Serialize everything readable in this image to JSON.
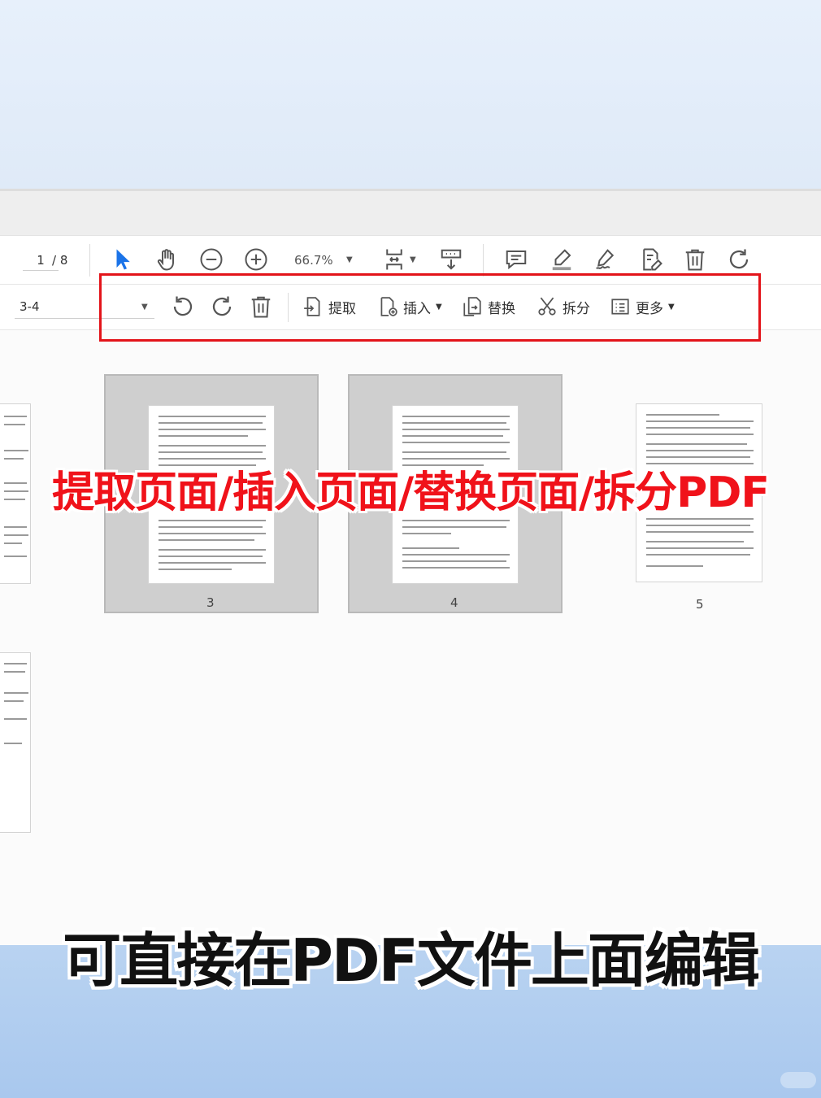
{
  "toolbar": {
    "current_page": "1",
    "total_pages": "/ 8",
    "zoom": "66.7%",
    "icons": [
      "select-arrow-icon",
      "hand-icon",
      "zoom-out-icon",
      "zoom-in-icon",
      "fit-page-icon",
      "scroll-mode-icon",
      "comment-icon",
      "highlight-icon",
      "sign-icon",
      "edit-text-icon",
      "delete-icon",
      "rotate-icon"
    ]
  },
  "organize": {
    "page_range": "3-4",
    "extract_label": "提取",
    "insert_label": "插入",
    "replace_label": "替换",
    "split_label": "拆分",
    "more_label": "更多",
    "accent_color": "#1a73e8"
  },
  "thumbnails": [
    {
      "label": "3",
      "selected": true
    },
    {
      "label": "4",
      "selected": true
    },
    {
      "label": "5",
      "selected": false
    }
  ],
  "overlay": {
    "headline": "提取页面/插入页面/替换页面/拆分PDF",
    "caption": "可直接在PDF文件上面编辑",
    "headline_color": "#f0121a",
    "highlight_box_color": "#e3141a"
  }
}
